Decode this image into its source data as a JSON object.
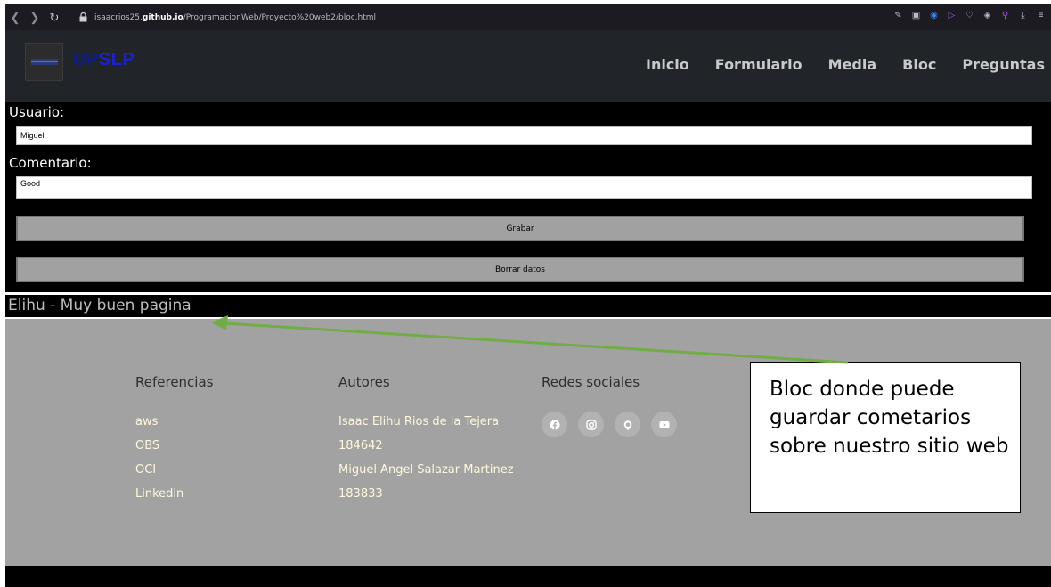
{
  "browser": {
    "url_prefix": "isaacrios25.",
    "url_domain": "github.io",
    "url_path": "/ProgramacionWeb/Proyecto%20web2/bloc.html",
    "icons": [
      "edit-icon",
      "screenshot-icon",
      "shield-icon",
      "play-icon",
      "heart-icon",
      "extension-icon",
      "account-icon",
      "download-icon",
      "menu-icon"
    ]
  },
  "header": {
    "brand_part1": "UP",
    "brand_part2": "SLP",
    "nav": [
      "Inicio",
      "Formulario",
      "Media",
      "Bloc",
      "Preguntas"
    ]
  },
  "form": {
    "usuario_label": "Usuario:",
    "usuario_value": "Miguel",
    "comentario_label": "Comentario:",
    "comentario_value": "Good",
    "grabar_label": "Grabar",
    "borrar_label": "Borrar datos"
  },
  "comment": {
    "text": "Elihu - Muy buen pagina"
  },
  "footer": {
    "referencias_title": "Referencias",
    "referencias": [
      "aws",
      "OBS",
      "OCI",
      "Linkedin"
    ],
    "autores_title": "Autores",
    "autores": [
      "Isaac Elihu Rios de la Tejera",
      "184642",
      "Miguel Angel Salazar Martinez",
      "183833"
    ],
    "redes_title": "Redes sociales",
    "redes_icons": [
      "facebook-icon",
      "instagram-icon",
      "github-icon",
      "youtube-icon"
    ]
  },
  "annotation": {
    "text": "Bloc donde puede guardar cometarios sobre nuestro sitio web",
    "arrow_color": "#70ad47"
  }
}
